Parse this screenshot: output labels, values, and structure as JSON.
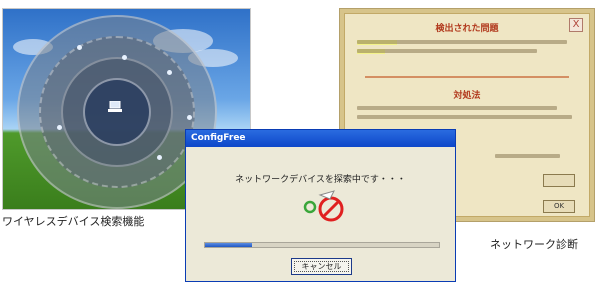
{
  "captions": {
    "left": "ワイヤレスデバイス検索機能",
    "right": "ネットワーク診断"
  },
  "dialog": {
    "title": "ConfigFree",
    "message": "ネットワークデバイスを探索中です・・・",
    "cancel_label": "キャンセル",
    "progress": 0.2
  },
  "diagnosis": {
    "problem_heading": "検出された問題",
    "solution_heading": "対処法",
    "close_glyph": "X",
    "ok_label": "OK"
  },
  "colors": {
    "titlebar": "#0d47c9",
    "dialog_bg": "#ece9d8",
    "diag_panel": "#efe6c4",
    "diag_heading": "#b23a1e",
    "no_sign": "#e02020"
  },
  "icons": {
    "radar": "wireless-radar-icon",
    "search": "device-search-icon",
    "prohibited": "no-entry-icon",
    "close": "close-icon"
  }
}
